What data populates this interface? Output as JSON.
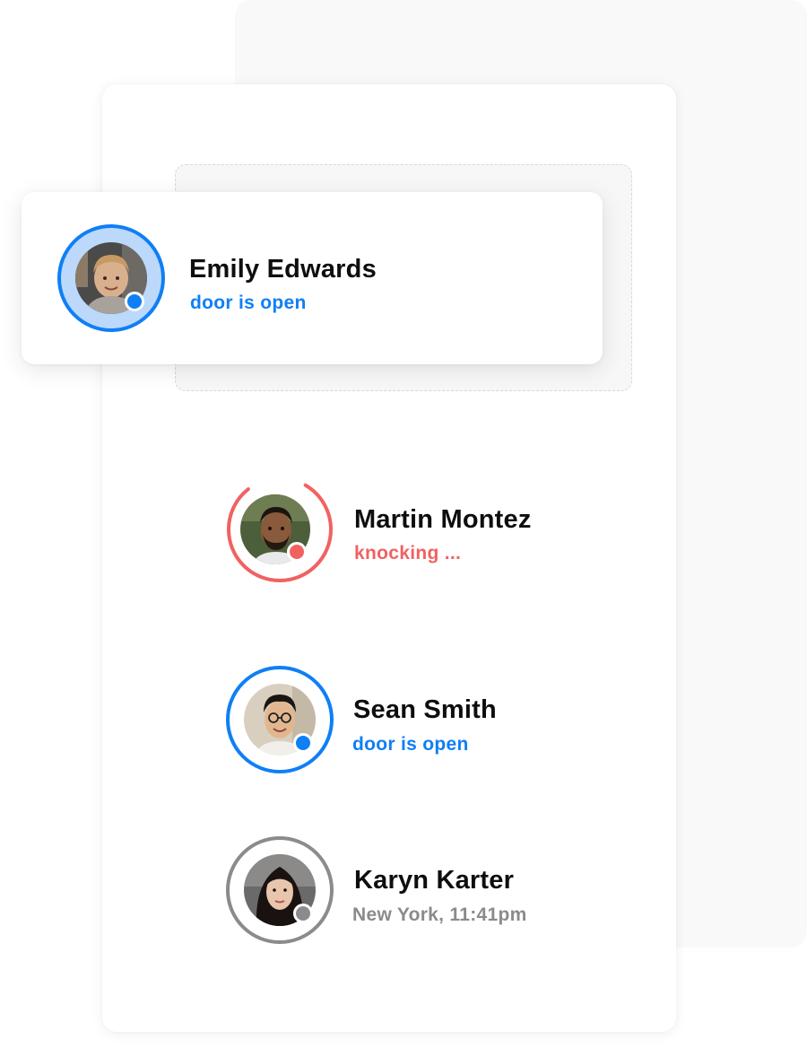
{
  "colors": {
    "open": "#0f7ff5",
    "knocking": "#f26161",
    "away": "#8b8b8e",
    "name": "#0e0e10"
  },
  "people": [
    {
      "name": "Emily Edwards",
      "status": "door is open",
      "state": "open"
    },
    {
      "name": "Martin Montez",
      "status": "knocking ...",
      "state": "knocking"
    },
    {
      "name": "Sean Smith",
      "status": "door is open",
      "state": "open"
    },
    {
      "name": "Karyn Karter",
      "status": "New York, 11:41pm",
      "state": "away"
    }
  ]
}
